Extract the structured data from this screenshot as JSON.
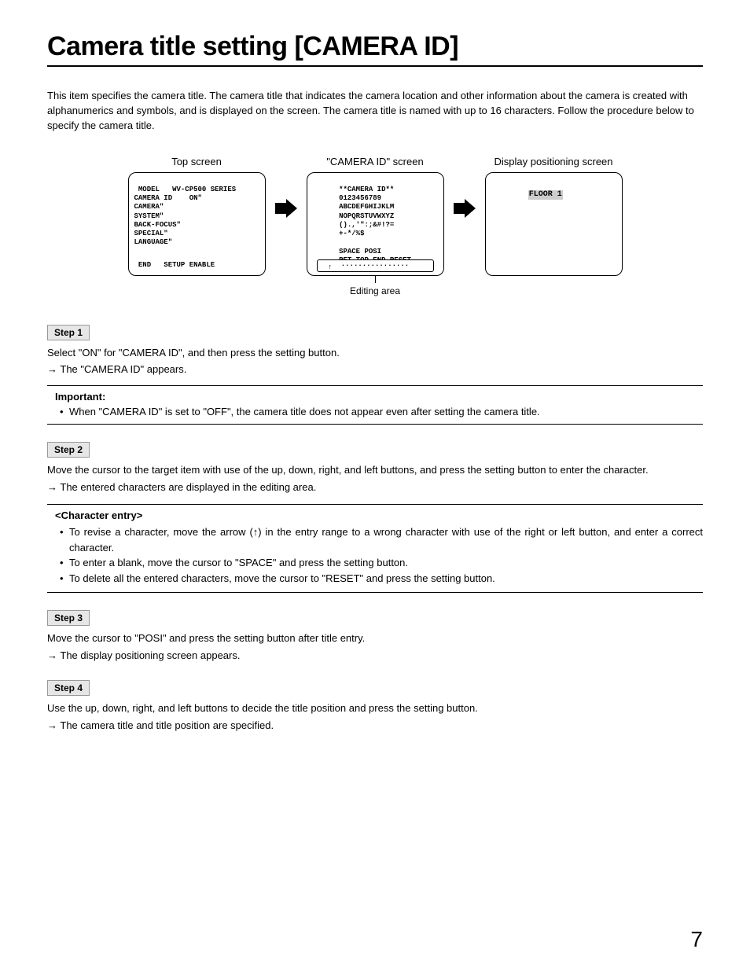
{
  "title": "Camera title setting [CAMERA ID]",
  "intro": "This item specifies the camera title. The camera title that indicates the camera location and other information about the camera is created with alphanumerics and symbols, and is displayed on the screen. The camera title is named with up to 16 characters. Follow the procedure below to specify the camera title.",
  "screens": {
    "top": {
      "label": "Top screen",
      "lines": {
        "l1": " MODEL   WV-CP500 SERIES",
        "l2": "CAMERA ID    ON\"",
        "l3": "CAMERA\"",
        "l4": "SYSTEM\"",
        "l5": "BACK-FOCUS\"",
        "l6": "SPECIAL\"",
        "l7": "LANGUAGE\"",
        "l8": " END   SETUP ENABLE"
      }
    },
    "camid": {
      "label": "\"CAMERA ID\" screen",
      "lines": {
        "l1": "**CAMERA ID**",
        "l2": "0123456789",
        "l3": "ABCDEFGHIJKLM",
        "l4": "NOPQRSTUVWXYZ",
        "l5": "().,'\":;&#!?=",
        "l6": "+-*/%$",
        "l7": "SPACE POSI",
        "l8": "RET TOP END RESET",
        "dots": "................"
      },
      "editing_label": "Editing area"
    },
    "pos": {
      "label": "Display positioning screen",
      "floor": "FLOOR 1"
    }
  },
  "steps": {
    "s1": {
      "badge": "Step 1",
      "body": "Select \"ON\" for \"CAMERA ID\", and then press the setting button.",
      "result": "The \"CAMERA ID\" appears.",
      "note_title": "Important:",
      "note_bullet": "When \"CAMERA ID\" is set to \"OFF\", the camera title does not appear even after setting the camera title."
    },
    "s2": {
      "badge": "Step 2",
      "body": "Move the cursor to the target item with use of the up, down, right, and left buttons, and press the setting button to enter the character.",
      "result": "The entered characters are displayed in the editing area.",
      "entry_title": "<Character entry>",
      "bullets": {
        "b1": "To revise a character, move the arrow (↑) in the entry range to a wrong character with use of the right or left button, and enter a correct character.",
        "b2": "To enter a blank, move the cursor to \"SPACE\" and press the setting button.",
        "b3": "To delete all the entered characters, move the cursor to \"RESET\" and press the setting button."
      }
    },
    "s3": {
      "badge": "Step 3",
      "body": "Move the cursor to \"POSI\" and press the setting button after title entry.",
      "result": "The display positioning screen appears."
    },
    "s4": {
      "badge": "Step 4",
      "body": "Use the up, down, right, and left buttons to decide the title position and press the setting button.",
      "result": "The camera title and title position are specified."
    }
  },
  "page_number": "7"
}
